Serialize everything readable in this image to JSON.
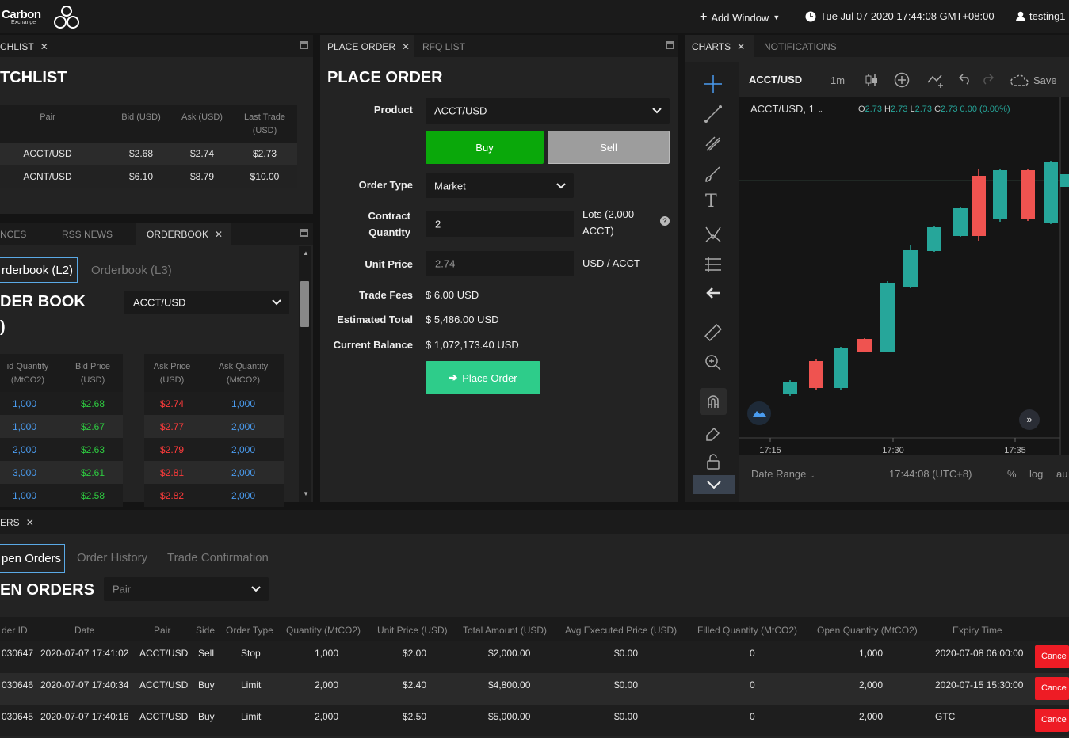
{
  "topbar": {
    "logo_name": "Carbon",
    "logo_sub": "Exchange",
    "add_window": "Add Window",
    "datetime": "Tue Jul 07 2020 17:44:08 GMT+08:00",
    "user": "testing1"
  },
  "watchlist": {
    "tab": "CHLIST",
    "title": "TCHLIST",
    "headers": [
      "Pair",
      "Bid (USD)",
      "Ask (USD)",
      "Last Trade (USD)"
    ],
    "rows": [
      [
        "ACCT/USD",
        "$2.68",
        "$2.74",
        "$2.73"
      ],
      [
        "ACNT/USD",
        "$6.10",
        "$8.79",
        "$10.00"
      ]
    ]
  },
  "orderbook_panel": {
    "tabs": [
      "NCES",
      "RSS NEWS",
      "ORDERBOOK"
    ],
    "subtabs": [
      "rderbook (L2)",
      "Orderbook (L3)"
    ],
    "title": "DER BOOK",
    "title2": ")",
    "pair": "ACCT/USD",
    "headers": [
      "id Quantity (MtCO2)",
      "Bid Price (USD)",
      "Ask Price (USD)",
      "Ask Quantity (MtCO2)"
    ],
    "rows": [
      [
        "1,000",
        "$2.68",
        "$2.74",
        "1,000"
      ],
      [
        "1,000",
        "$2.67",
        "$2.77",
        "2,000"
      ],
      [
        "2,000",
        "$2.63",
        "$2.79",
        "2,000"
      ],
      [
        "3,000",
        "$2.61",
        "$2.81",
        "2,000"
      ],
      [
        "1,000",
        "$2.58",
        "$2.82",
        "2,000"
      ]
    ]
  },
  "place_order": {
    "tabs": [
      "PLACE ORDER",
      "RFQ LIST"
    ],
    "title": "PLACE ORDER",
    "product_label": "Product",
    "product": "ACCT/USD",
    "buy": "Buy",
    "sell": "Sell",
    "order_type_label": "Order Type",
    "order_type": "Market",
    "contract_label_1": "Contract",
    "contract_label_2": "Quantity",
    "contract_qty": "2",
    "lots_1": "Lots (2,000",
    "lots_2": "ACCT)",
    "unit_price_label": "Unit Price",
    "unit_price": "2.74",
    "unit_suffix": "USD / ACCT",
    "fees_label": "Trade Fees",
    "fees": "$ 6.00 USD",
    "est_label": "Estimated Total",
    "est": "$ 5,486.00 USD",
    "balance_label": "Current Balance",
    "balance": "$ 1,072,173.40 USD",
    "place_button": "Place Order"
  },
  "charts": {
    "tabs": [
      "CHARTS",
      "NOTIFICATIONS"
    ],
    "symbol": "ACCT/USD",
    "interval": "1m",
    "save": "Save",
    "legend_symbol": "ACCT/USD, 1",
    "ohlc_o_label": "O",
    "ohlc_o": "2.73",
    "ohlc_h_label": "H",
    "ohlc_h": "2.73",
    "ohlc_l_label": "L",
    "ohlc_l": "2.73",
    "ohlc_c_label": "C",
    "ohlc_c": "2.73",
    "change": "0.00 (0.00%)",
    "date_range": "Date Range",
    "clock": "17:44:08 (UTC+8)",
    "pct": "%",
    "log": "log",
    "auto": "au",
    "x_ticks": [
      "17:15",
      "17:30",
      "17:35"
    ],
    "colors": {
      "up": "#26a69a",
      "down": "#ef5350"
    }
  },
  "chart_data": {
    "type": "candlestick",
    "x": [
      "17:15",
      "17:30",
      "17:35"
    ],
    "candles_direction": [
      "up",
      "down",
      "up",
      "down",
      "up",
      "up",
      "up",
      "up",
      "down",
      "up",
      "down",
      "up"
    ]
  },
  "orders": {
    "tab": "ERS",
    "subtabs": [
      "pen Orders",
      "Order History",
      "Trade Confirmation"
    ],
    "title": "EN ORDERS",
    "pair_placeholder": "Pair",
    "headers": [
      "der ID",
      "Date",
      "Pair",
      "Side",
      "Order Type",
      "Quantity (MtCO2)",
      "Unit Price (USD)",
      "Total Amount (USD)",
      "Avg Executed Price (USD)",
      "Filled Quantity (MtCO2)",
      "Open Quantity (MtCO2)",
      "Expiry Time"
    ],
    "rows": [
      [
        "030647",
        "2020-07-07 17:41:02",
        "ACCT/USD",
        "Sell",
        "Stop",
        "1,000",
        "$2.00",
        "$2,000.00",
        "$0.00",
        "0",
        "1,000",
        "2020-07-08 06:00:00"
      ],
      [
        "030646",
        "2020-07-07 17:40:34",
        "ACCT/USD",
        "Buy",
        "Limit",
        "2,000",
        "$2.40",
        "$4,800.00",
        "$0.00",
        "0",
        "2,000",
        "2020-07-15 15:30:00"
      ],
      [
        "030645",
        "2020-07-07 17:40:16",
        "ACCT/USD",
        "Buy",
        "Limit",
        "2,000",
        "$2.50",
        "$5,000.00",
        "$0.00",
        "0",
        "2,000",
        "GTC"
      ]
    ],
    "cancel": "Cance"
  }
}
